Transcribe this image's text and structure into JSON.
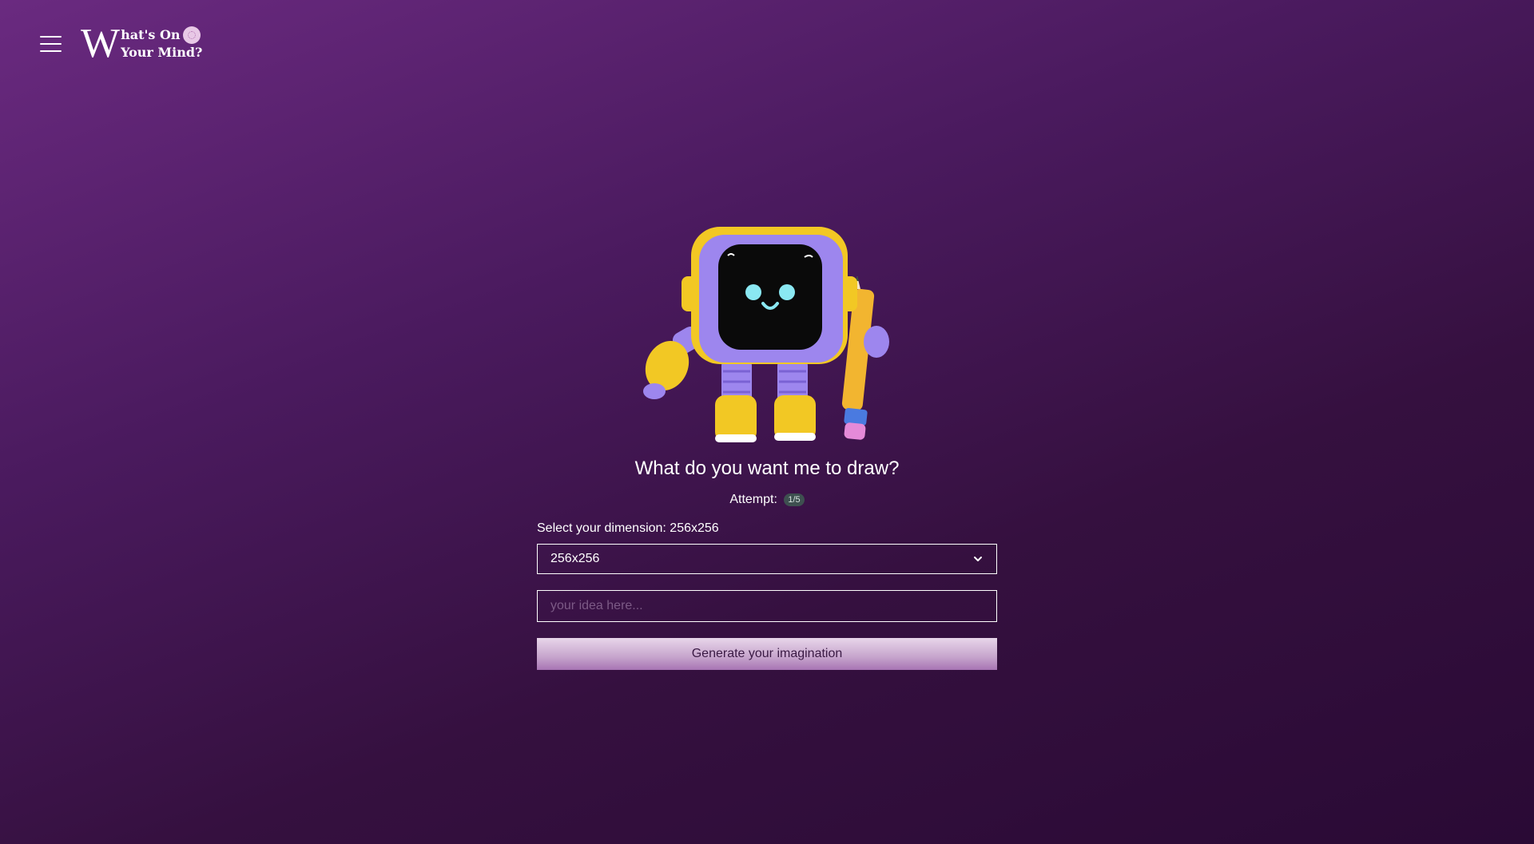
{
  "header": {
    "logo_initial": "W",
    "logo_line1": "hat's On",
    "logo_line2": "Your Mind?",
    "menu_icon": "hamburger-menu-icon",
    "brain_icon": "brain-icon"
  },
  "main": {
    "illustration": "robot-with-pencil",
    "question": "What do you want me to draw?",
    "attempt_label": "Attempt:",
    "attempt_value": "1/5",
    "dimension_label": "Select your dimension: 256x256",
    "dimension_selected": "256x256",
    "idea_placeholder": "your idea here...",
    "idea_value": "",
    "generate_label": "Generate your imagination"
  },
  "colors": {
    "background_top": "#6a2a80",
    "background_bottom": "#2a0a35",
    "button_gradient_start": "#e8d6ea",
    "button_gradient_end": "#a774b4",
    "badge": "#3e5050"
  }
}
